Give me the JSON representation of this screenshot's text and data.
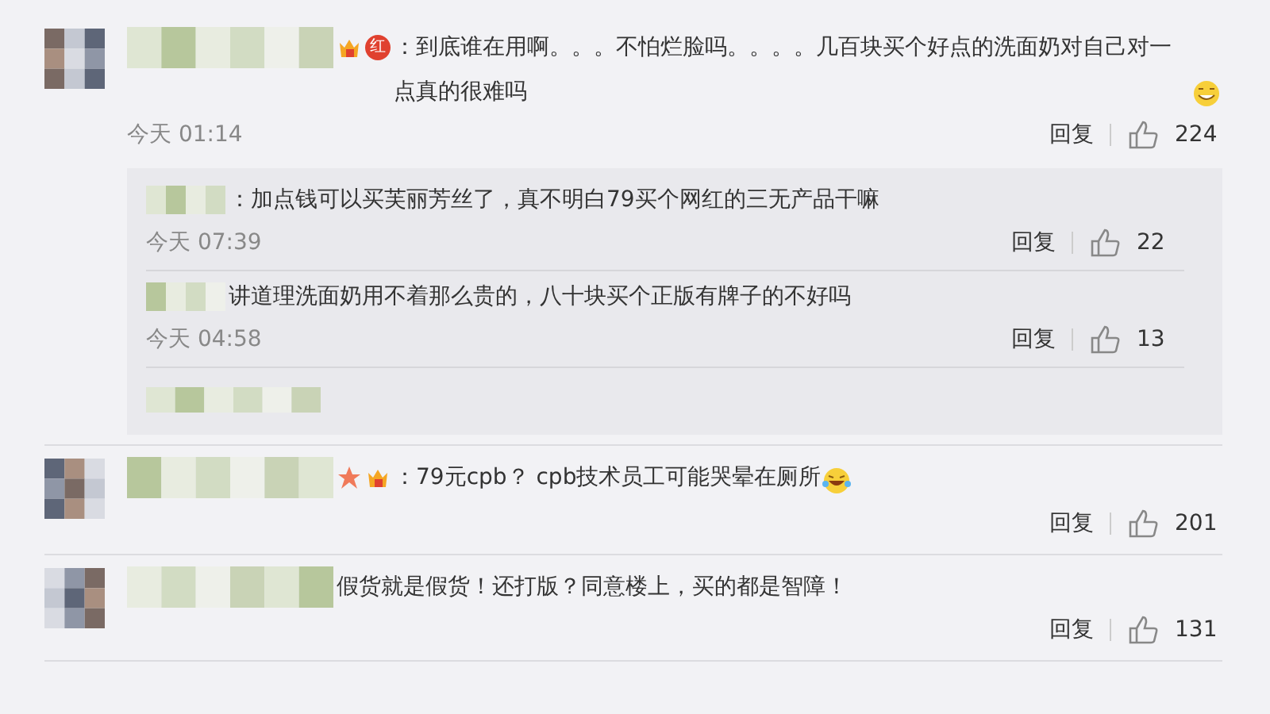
{
  "comments": [
    {
      "badges": [
        {
          "kind": "crown"
        },
        {
          "kind": "seal",
          "label": "红"
        }
      ],
      "text": "：到底谁在用啊。。。不怕烂脸吗。。。。几百块买个好点的洗面奶对自己对一点真的很难吗",
      "emoji": {
        "kind": "grin"
      },
      "time": "今天 01:14",
      "reply_label": "回复",
      "likes": "224",
      "replies": [
        {
          "text": "：加点钱可以买芙丽芳丝了，真不明白79买个网红的三无产品干嘛",
          "time": "今天 07:39",
          "reply_label": "回复",
          "likes": "22"
        },
        {
          "text": "讲道理洗面奶用不着那么贵的，八十块买个正版有牌子的不好吗",
          "time": "今天 04:58",
          "reply_label": "回复",
          "likes": "13"
        }
      ]
    },
    {
      "badges": [
        {
          "kind": "star"
        },
        {
          "kind": "crown"
        }
      ],
      "text": "：79元cpb？  cpb技术员工可能哭晕在厕所",
      "emoji": {
        "kind": "laugh"
      },
      "reply_label": "回复",
      "likes": "201"
    },
    {
      "text": "假货就是假货！还打版？同意楼上，买的都是智障！",
      "reply_label": "回复",
      "likes": "131"
    }
  ]
}
